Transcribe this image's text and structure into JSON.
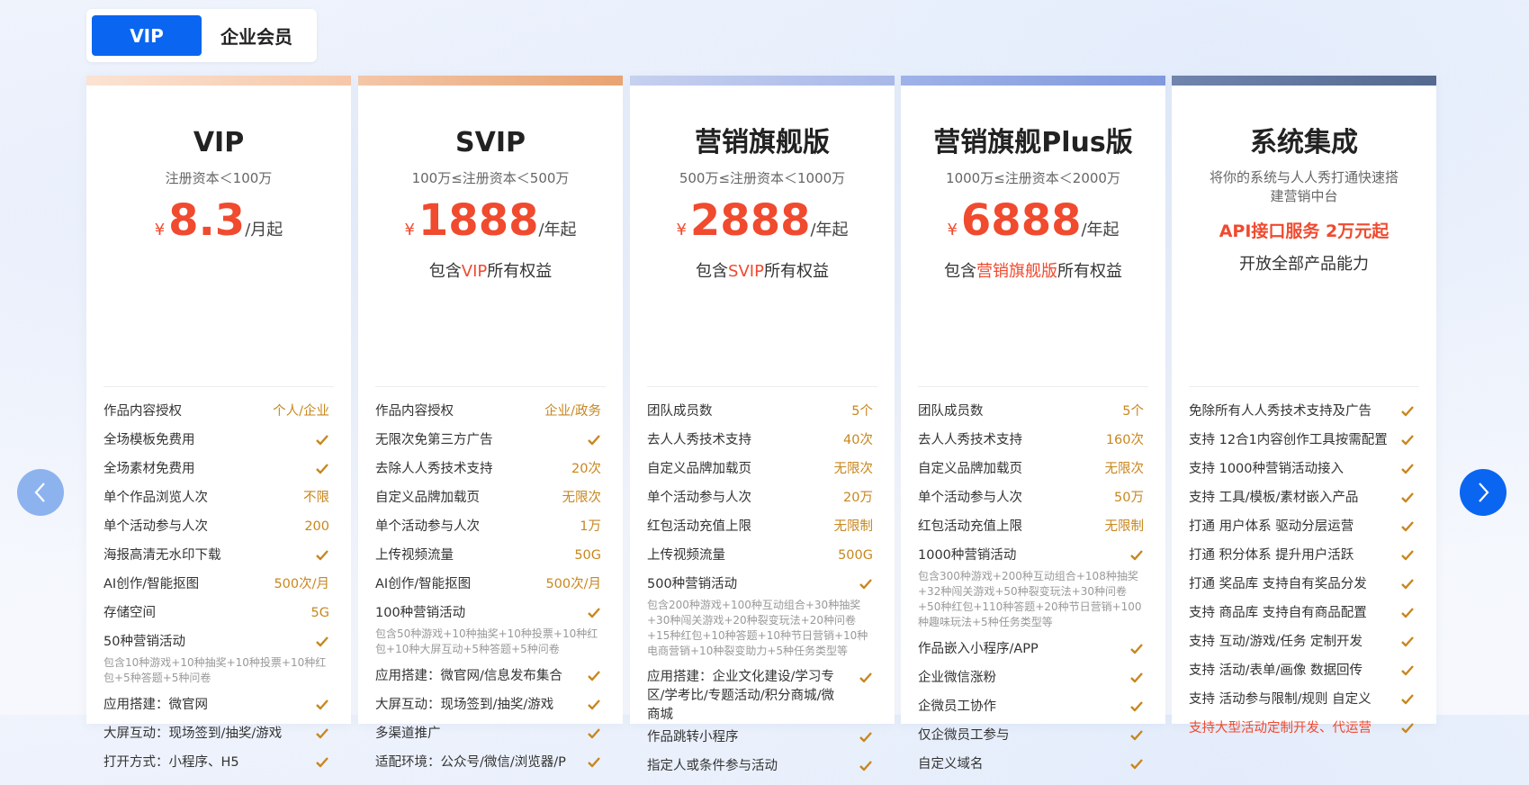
{
  "tabs": {
    "vip": "VIP",
    "enterprise": "企业会员"
  },
  "colors": {
    "accent_blue": "#0a66f0",
    "price_red": "#f04a2f",
    "value_gold": "#c8871e"
  },
  "cards": [
    {
      "name": "VIP",
      "cond": "注册资本＜100万",
      "currency": "¥",
      "price": "8.3",
      "unit": "/月起",
      "incl_pre": "",
      "incl_hl": "",
      "incl_post": "",
      "features": [
        {
          "label": "作品内容授权",
          "value": "个人/企业"
        },
        {
          "label": "全场模板免费用",
          "value": "check"
        },
        {
          "label": "全场素材免费用",
          "value": "check"
        },
        {
          "label": "单个作品浏览人次",
          "value": "不限"
        },
        {
          "label": "单个活动参与人次",
          "value": "200"
        },
        {
          "label": "海报高清无水印下载",
          "value": "check"
        },
        {
          "label": "AI创作/智能抠图",
          "value": "500次/月"
        },
        {
          "label": "存储空间",
          "value": "5G"
        },
        {
          "label": "50种营销活动",
          "value": "check",
          "note": "包含10种游戏+10种抽奖+10种投票+10种红包+5种答题+5种问卷"
        },
        {
          "label": "应用搭建：微官网",
          "value": "check"
        },
        {
          "label": "大屏互动：现场签到/抽奖/游戏",
          "value": "check"
        },
        {
          "label": "打开方式：小程序、H5",
          "value": "check"
        }
      ]
    },
    {
      "name": "SVIP",
      "cond": "100万≤注册资本＜500万",
      "currency": "¥",
      "price": "1888",
      "unit": "/年起",
      "incl_pre": "包含",
      "incl_hl": "VIP",
      "incl_post": "所有权益",
      "features": [
        {
          "label": "作品内容授权",
          "value": "企业/政务"
        },
        {
          "label": "无限次免第三方广告",
          "value": "check"
        },
        {
          "label": "去除人人秀技术支持",
          "value": "20次"
        },
        {
          "label": "自定义品牌加载页",
          "value": "无限次"
        },
        {
          "label": "单个活动参与人次",
          "value": "1万"
        },
        {
          "label": "上传视频流量",
          "value": "50G"
        },
        {
          "label": "AI创作/智能抠图",
          "value": "500次/月"
        },
        {
          "label": "100种营销活动",
          "value": "check",
          "note": "包含50种游戏+10种抽奖+10种投票+10种红包+10种大屏互动+5种答题+5种问卷"
        },
        {
          "label": "应用搭建：微官网/信息发布集合",
          "value": "check"
        },
        {
          "label": "大屏互动：现场签到/抽奖/游戏",
          "value": "check"
        },
        {
          "label": "多渠道推广",
          "value": "check"
        },
        {
          "label": "适配环境：公众号/微信/浏览器/P",
          "value": "check"
        }
      ]
    },
    {
      "name": "营销旗舰版",
      "cond": "500万≤注册资本＜1000万",
      "currency": "¥",
      "price": "2888",
      "unit": "/年起",
      "incl_pre": "包含",
      "incl_hl": "SVIP",
      "incl_post": "所有权益",
      "features": [
        {
          "label": "团队成员数",
          "value": "5个"
        },
        {
          "label": "去人人秀技术支持",
          "value": "40次"
        },
        {
          "label": "自定义品牌加载页",
          "value": "无限次"
        },
        {
          "label": "单个活动参与人次",
          "value": "20万"
        },
        {
          "label": "红包活动充值上限",
          "value": "无限制"
        },
        {
          "label": "上传视频流量",
          "value": "500G"
        },
        {
          "label": "500种营销活动",
          "value": "check",
          "note": "包含200种游戏+100种互动组合+30种抽奖+30种闯关游戏+20种裂变玩法+20种问卷+15种红包+10种答题+10种节日营销+10种电商营销+10种裂变助力+5种任务类型等"
        },
        {
          "label": "应用搭建：企业文化建设/学习专区/学考比/专题活动/积分商城/微商城",
          "value": "check",
          "tall": true
        },
        {
          "label": "作品跳转小程序",
          "value": "check"
        },
        {
          "label": "指定人或条件参与活动",
          "value": "check"
        }
      ]
    },
    {
      "name": "营销旗舰Plus版",
      "cond": "1000万≤注册资本＜2000万",
      "currency": "¥",
      "price": "6888",
      "unit": "/年起",
      "incl_pre": "包含",
      "incl_hl": "营销旗舰版",
      "incl_post": "所有权益",
      "features": [
        {
          "label": "团队成员数",
          "value": "5个"
        },
        {
          "label": "去人人秀技术支持",
          "value": "160次"
        },
        {
          "label": "自定义品牌加载页",
          "value": "无限次"
        },
        {
          "label": "单个活动参与人次",
          "value": "50万"
        },
        {
          "label": "红包活动充值上限",
          "value": "无限制"
        },
        {
          "label": "1000种营销活动",
          "value": "check",
          "note": "包含300种游戏+200种互动组合+108种抽奖+32种闯关游戏+50种裂变玩法+30种问卷+50种红包+110种答题+20种节日营销+100种趣味玩法+5种任务类型等"
        },
        {
          "label": "作品嵌入小程序/APP",
          "value": "check"
        },
        {
          "label": "企业微信涨粉",
          "value": "check"
        },
        {
          "label": "企微员工协作",
          "value": "check"
        },
        {
          "label": "仅企微员工参与",
          "value": "check"
        },
        {
          "label": "自定义域名",
          "value": "check"
        }
      ]
    },
    {
      "name": "系统集成",
      "cond": "将你的系统与人人秀打通快速搭建营销中台",
      "api": "API接口服务 2万元起",
      "open": "开放全部产品能力",
      "features": [
        {
          "label": "免除所有人人秀技术支持及广告",
          "value": "check"
        },
        {
          "label": "支持 12合1内容创作工具按需配置",
          "value": "check"
        },
        {
          "label": "支持 1000种营销活动接入",
          "value": "check"
        },
        {
          "label": "支持 工具/模板/素材嵌入产品",
          "value": "check"
        },
        {
          "label": "打通 用户体系 驱动分层运营",
          "value": "check"
        },
        {
          "label": "打通 积分体系 提升用户活跃",
          "value": "check"
        },
        {
          "label": "打通 奖品库 支持自有奖品分发",
          "value": "check"
        },
        {
          "label": "支持 商品库 支持自有商品配置",
          "value": "check"
        },
        {
          "label": "支持 互动/游戏/任务 定制开发",
          "value": "check"
        },
        {
          "label": "支持 活动/表单/画像 数据回传",
          "value": "check"
        },
        {
          "label": "支持 活动参与限制/规则 自定义",
          "value": "check"
        },
        {
          "label": "支持大型活动定制开发、代运营",
          "value": "check",
          "red": true
        }
      ]
    }
  ],
  "nav": {
    "prev_icon": "chevron-left-icon",
    "next_icon": "chevron-right-icon"
  }
}
